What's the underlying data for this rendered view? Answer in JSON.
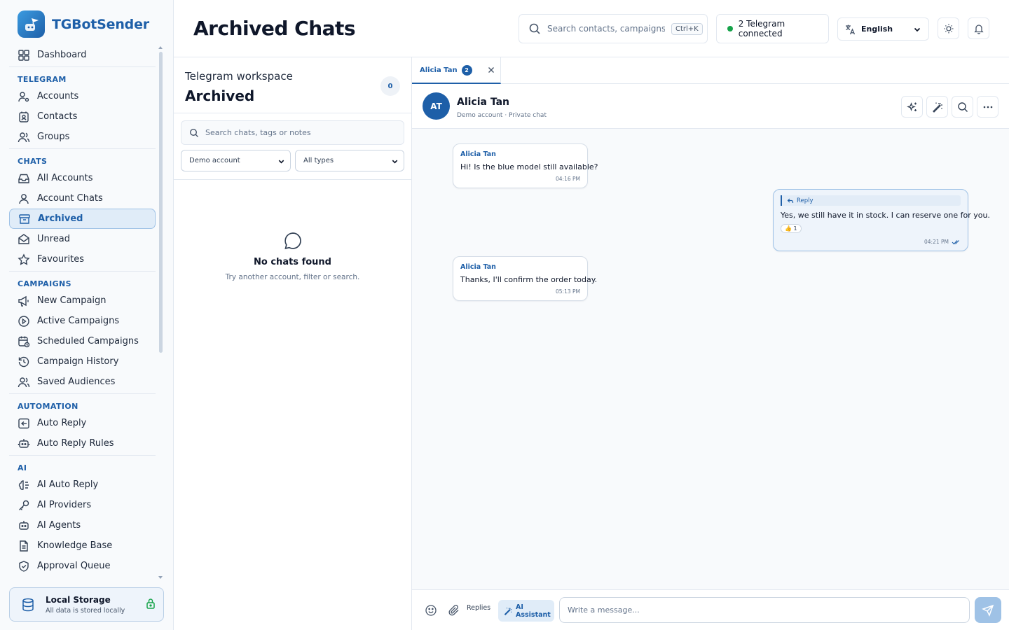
{
  "app": {
    "name": "TGBotSender"
  },
  "header": {
    "title": "Archived Chats",
    "search_placeholder": "Search contacts, campaigns, t...",
    "shortcut": "Ctrl+K",
    "connection_status": "2 Telegram connected",
    "language": "English"
  },
  "sidebar": {
    "dashboard": "Dashboard",
    "sections": {
      "telegram": "TELEGRAM",
      "chats": "CHATS",
      "campaigns": "CAMPAIGNS",
      "automation": "AUTOMATION",
      "ai": "AI"
    },
    "telegram_items": [
      "Accounts",
      "Contacts",
      "Groups"
    ],
    "chats_items": [
      "All Accounts",
      "Account Chats",
      "Archived",
      "Unread",
      "Favourites"
    ],
    "campaign_items": [
      "New Campaign",
      "Active Campaigns",
      "Scheduled Campaigns",
      "Campaign History",
      "Saved Audiences"
    ],
    "automation_items": [
      "Auto Reply",
      "Auto Reply Rules"
    ],
    "ai_items": [
      "AI Auto Reply",
      "AI Providers",
      "AI Agents",
      "Knowledge Base",
      "Approval Queue"
    ],
    "storage": {
      "title": "Local Storage",
      "subtitle": "All data is stored locally"
    }
  },
  "list_panel": {
    "workspace": "Telegram workspace",
    "title": "Archived",
    "count": "0",
    "search_placeholder": "Search chats, tags or notes",
    "account_filter": "Demo account",
    "type_filter": "All types",
    "empty_title": "No chats found",
    "empty_subtitle": "Try another account, filter or search."
  },
  "conversation": {
    "tab": {
      "label": "Alicia Tan",
      "badge": "2"
    },
    "contact": {
      "initials": "AT",
      "name": "Alicia Tan",
      "meta": "Demo account · Private chat"
    },
    "messages": [
      {
        "sender": "Alicia Tan",
        "text": "Hi! Is the blue model still available?",
        "time": "04:16 PM"
      },
      {
        "reply_label": "Reply",
        "text": "Yes, we still have it in stock. I can reserve one for you.",
        "reaction": "👍 1",
        "time": "04:21 PM"
      },
      {
        "sender": "Alicia Tan",
        "text": "Thanks, I'll confirm the order today.",
        "time": "05:13 PM"
      }
    ],
    "composer": {
      "replies_label": "Replies",
      "ai_label": "AI Assistant",
      "placeholder": "Write a message..."
    }
  },
  "colors": {
    "accent": "#1e5fa8",
    "accent_light": "#e0ecf8",
    "online": "#16a34a"
  }
}
